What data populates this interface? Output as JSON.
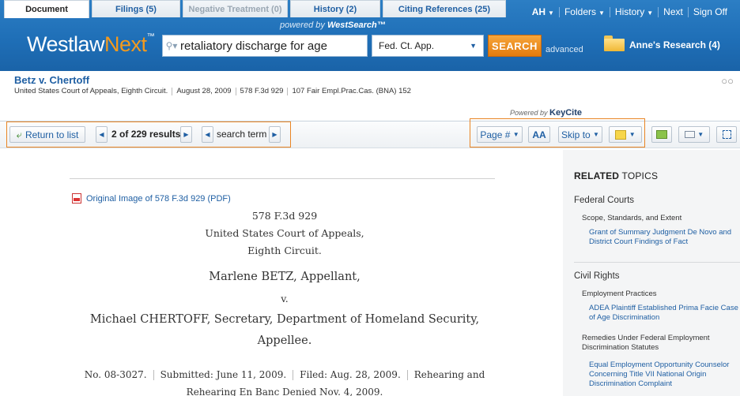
{
  "header": {
    "powered_prefix": "powered by",
    "powered_brand": "WestSearch™",
    "brand_main": "Westlaw",
    "brand_accent": "Next",
    "brand_tm": "™",
    "search_value": "retaliatory discharge for age",
    "jurisdiction": "Fed. Ct. App.",
    "search_button": "SEARCH",
    "advanced_label": "advanced",
    "research_folder": "Anne's Research (4)",
    "nav": {
      "user": "AH",
      "folders": "Folders",
      "history": "History",
      "next": "Next",
      "signoff": "Sign Off"
    }
  },
  "document": {
    "title": "Betz v. Chertoff",
    "citation": [
      "United States Court of Appeals, Eighth Circuit.",
      "August 28, 2009",
      "578 F.3d 929",
      "107 Fair Empl.Prac.Cas. (BNA) 152"
    ]
  },
  "tabs": [
    {
      "label": "Document",
      "state": "active"
    },
    {
      "label": "Filings (5)",
      "state": "normal"
    },
    {
      "label": "Negative Treatment (0)",
      "state": "disabled"
    },
    {
      "label": "History (2)",
      "state": "normal"
    },
    {
      "label": "Citing References (25)",
      "state": "normal"
    }
  ],
  "keycite": {
    "prefix": "Powered by",
    "brand": "KeyCite"
  },
  "toolbar": {
    "return_label": "Return to list",
    "results_position": "2",
    "results_of": "of 229 results",
    "search_term": "search term",
    "page_label": "Page #",
    "aa_label": "AA",
    "skip_label": "Skip to"
  },
  "body": {
    "pdf_link": "Original Image of 578 F.3d 929 (PDF)",
    "lines": [
      "578 F.3d 929",
      "United States Court of Appeals,",
      "Eighth Circuit.",
      "Marlene BETZ, Appellant,",
      "v.",
      "Michael CHERTOFF, Secretary, Department of Homeland Security,",
      "Appellee."
    ],
    "docket": [
      "No. 08-3027.",
      "Submitted: June 11, 2009.",
      "Filed: Aug. 28, 2009.",
      "Rehearing and"
    ],
    "docket_line2": "Rehearing En Banc Denied Nov. 4, 2009."
  },
  "related": {
    "heading_bold": "RELATED",
    "heading_rest": " TOPICS",
    "cat1": "Federal Courts",
    "cat1_sub": "Scope, Standards, and Extent",
    "cat1_link": "Grant of Summary Judgment De Novo and District Court Findings of Fact",
    "cat2": "Civil Rights",
    "cat2_sub1": "Employment Practices",
    "cat2_link1": "ADEA Plaintiff Established Prima Facie Case of Age Discrimination",
    "cat2_sub2": "Remedies Under Federal Employment Discrimination Statutes",
    "cat2_link2": "Equal Employment Opportunity Counselor Concerning Title VII National Origin Discrimination Complaint"
  },
  "colors": {
    "header_blue": "#1f6fb7",
    "accent_orange": "#f49a1d",
    "link_blue": "#1f5fa3",
    "highlight_orange": "#e98524"
  }
}
